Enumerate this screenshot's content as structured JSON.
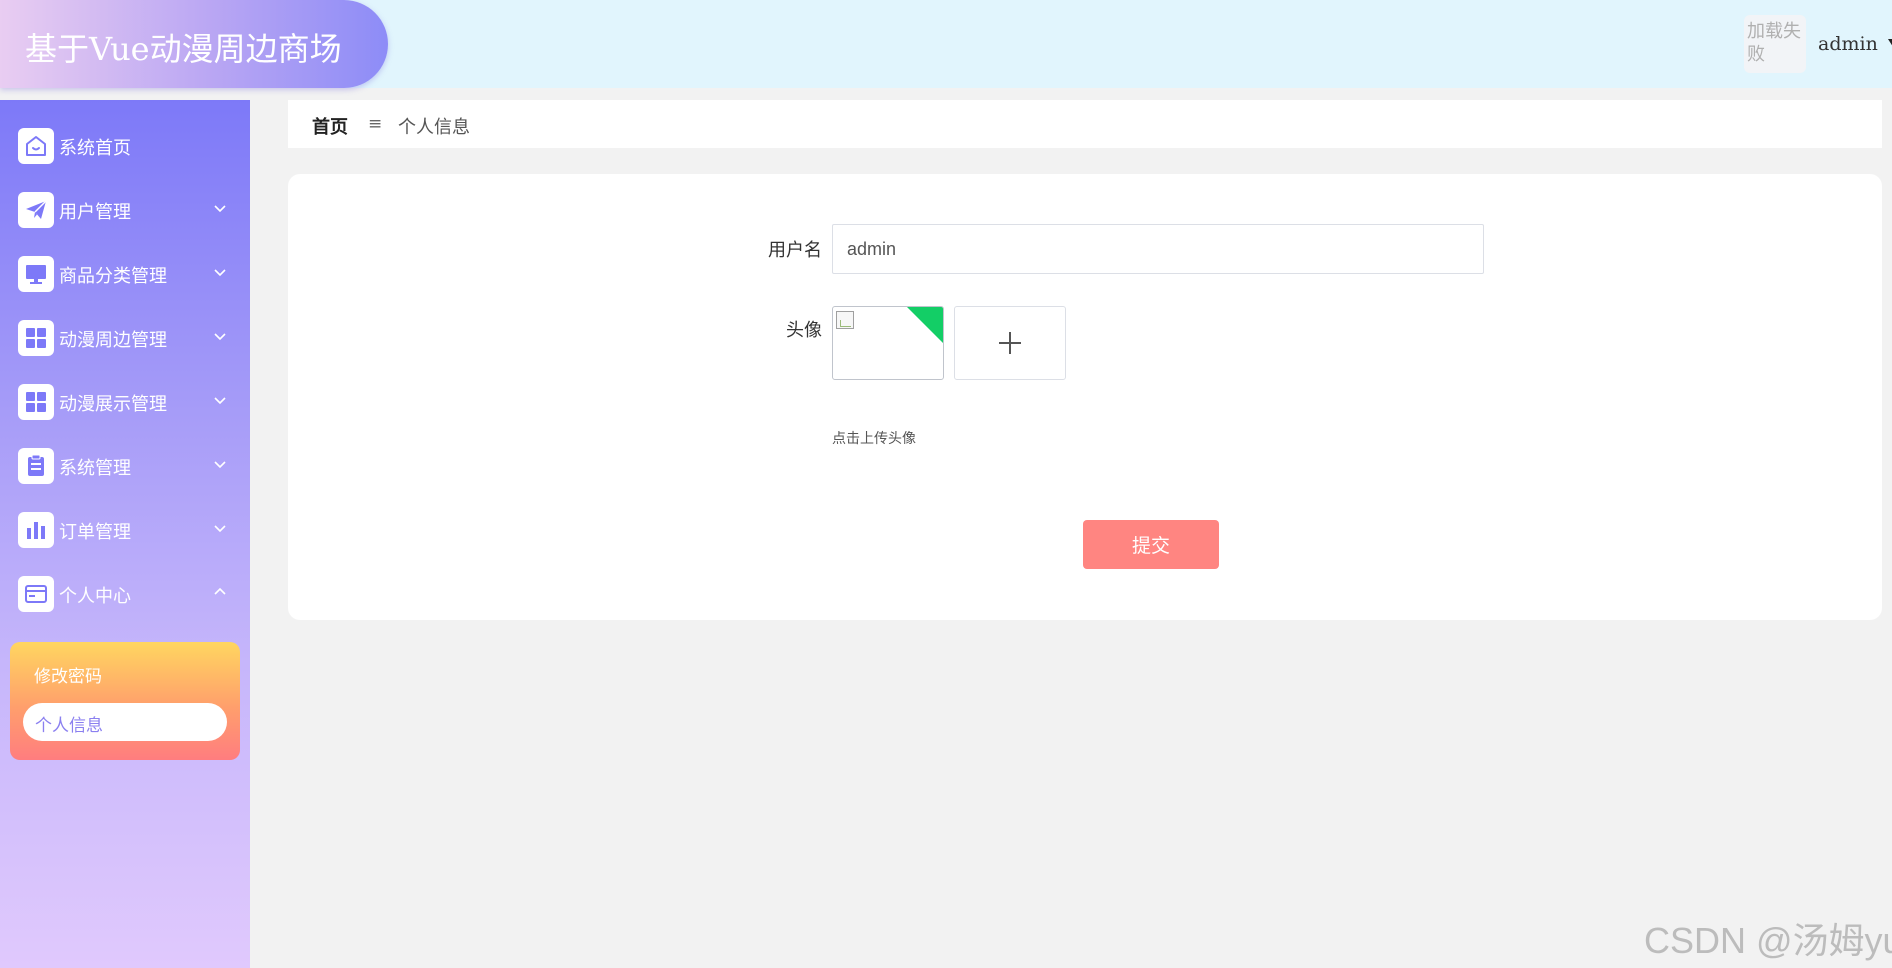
{
  "header": {
    "title": "基于Vue动漫周边商场",
    "avatar_alt": "加载失败",
    "username": "admin"
  },
  "sidebar": {
    "items": [
      {
        "label": "系统首页",
        "icon": "home-icon",
        "expandable": false
      },
      {
        "label": "用户管理",
        "icon": "paper-plane-icon",
        "expandable": true,
        "expanded": false
      },
      {
        "label": "商品分类管理",
        "icon": "monitor-icon",
        "expandable": true,
        "expanded": false
      },
      {
        "label": "动漫周边管理",
        "icon": "grid-icon",
        "expandable": true,
        "expanded": false
      },
      {
        "label": "动漫展示管理",
        "icon": "grid-icon",
        "expandable": true,
        "expanded": false
      },
      {
        "label": "系统管理",
        "icon": "clipboard-icon",
        "expandable": true,
        "expanded": false
      },
      {
        "label": "订单管理",
        "icon": "bar-chart-icon",
        "expandable": true,
        "expanded": false
      },
      {
        "label": "个人中心",
        "icon": "card-icon",
        "expandable": true,
        "expanded": true
      }
    ],
    "submenu": {
      "items": [
        "修改密码",
        "个人信息"
      ],
      "active": "个人信息"
    }
  },
  "breadcrumb": {
    "home": "首页",
    "separator": "≡",
    "current": "个人信息"
  },
  "form": {
    "username_label": "用户名",
    "username_value": "admin",
    "avatar_label": "头像",
    "upload_hint": "点击上传头像",
    "submit_label": "提交"
  },
  "watermark": "CSDN @汤姆yu",
  "colors": {
    "header_bg": "#e1f5fd",
    "sidebar_top": "#7d79f8",
    "sidebar_bottom": "#e0c9fd",
    "submenu_top": "#ffd660",
    "submenu_bottom": "#ff7d7f",
    "submit_bg": "#ff8581",
    "upload_success": "#13ce66"
  }
}
